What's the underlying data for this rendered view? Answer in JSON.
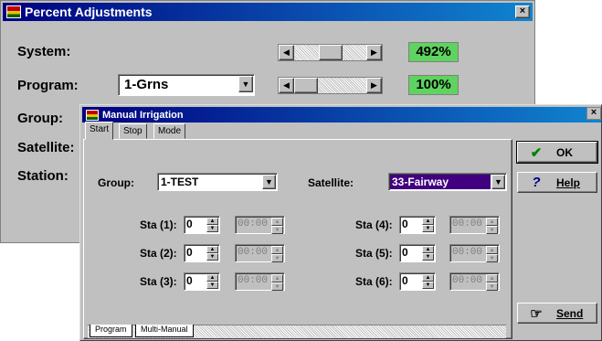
{
  "percent_window": {
    "title": "Percent Adjustments",
    "close_label": "×",
    "labels": {
      "system": "System:",
      "program": "Program:",
      "group": "Group:",
      "satellite": "Satellite:",
      "station": "Station:"
    },
    "program_combo_value": "1-Grns",
    "system_percent": "492%",
    "program_percent": "100%",
    "percent_color": "#5fd35f"
  },
  "manual_window": {
    "title": "Manual Irrigation",
    "close_label": "×",
    "tabs": [
      "Start",
      "Stop",
      "Mode"
    ],
    "group_label": "Group:",
    "group_value": "1-TEST",
    "satellite_label": "Satellite:",
    "satellite_value": "33-Fairway",
    "stations": [
      {
        "label": "Sta (1):",
        "value": "0",
        "time": "00:00"
      },
      {
        "label": "Sta (2):",
        "value": "0",
        "time": "00:00"
      },
      {
        "label": "Sta (3):",
        "value": "0",
        "time": "00:00"
      },
      {
        "label": "Sta (4):",
        "value": "0",
        "time": "00:00"
      },
      {
        "label": "Sta (5):",
        "value": "0",
        "time": "00:00"
      },
      {
        "label": "Sta (6):",
        "value": "0",
        "time": "00:00"
      }
    ],
    "bottom_tabs": [
      "Program",
      "Multi-Manual"
    ],
    "buttons": {
      "ok": "OK",
      "help": "Help",
      "send": "Send"
    },
    "icons": {
      "ok": "checkmark-icon",
      "help": "question-mark-icon",
      "send": "pointing-hand-icon"
    },
    "highlight_color": "#400080"
  }
}
